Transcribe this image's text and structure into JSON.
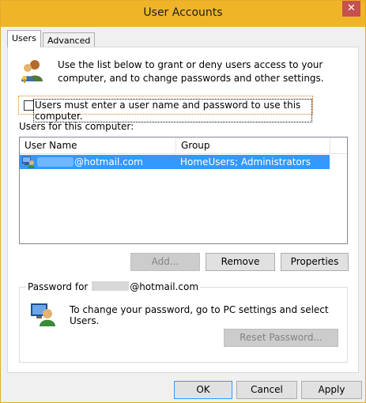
{
  "window": {
    "title": "User Accounts",
    "close_glyph": "✕"
  },
  "tabs": [
    {
      "label": "Users"
    },
    {
      "label": "Advanced"
    }
  ],
  "intro": {
    "icon": "users-icon",
    "text": "Use the list below to grant or deny users access to your computer, and to change passwords and other settings."
  },
  "require_login": {
    "checked": false,
    "label": "Users must enter a user name and password to use this computer."
  },
  "users_list": {
    "label": "Users for this computer:",
    "columns": [
      "User Name",
      "Group"
    ],
    "rows": [
      {
        "icon": "user-icon",
        "name": "@hotmail.com",
        "group": "HomeUsers; Administrators",
        "selected": true
      }
    ]
  },
  "list_buttons": {
    "add": "Add...",
    "remove": "Remove",
    "properties": "Properties"
  },
  "password_group": {
    "legend_prefix": "Password for",
    "legend_suffix": "@hotmail.com",
    "icon": "user-computer-icon",
    "text": "To change your password, go to PC settings and select Users.",
    "reset_button": "Reset Password..."
  },
  "dialog_buttons": {
    "ok": "OK",
    "cancel": "Cancel",
    "apply": "Apply"
  },
  "colors": {
    "titlebar": "#f0b429",
    "selection": "#3399ff",
    "close": "#c75050"
  }
}
